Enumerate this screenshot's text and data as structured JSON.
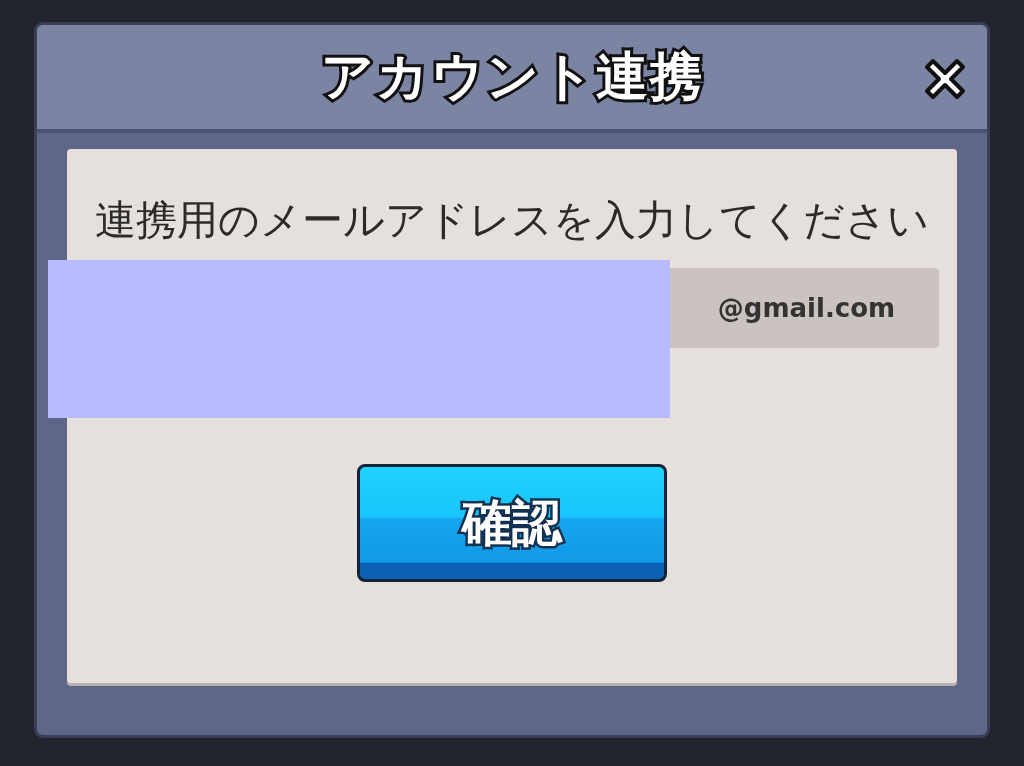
{
  "dialog": {
    "title": "アカウント連携",
    "instruction": "連携用のメールアドレスを入力してください",
    "email_field": {
      "suffix": "@gmail.com"
    },
    "confirm_button": "確認"
  }
}
